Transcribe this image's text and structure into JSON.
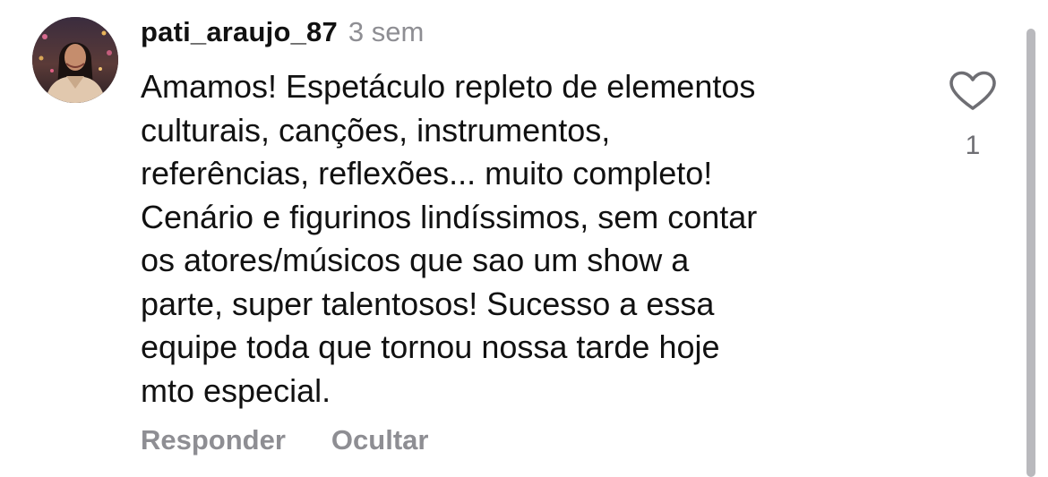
{
  "comment": {
    "username": "pati_araujo_87",
    "timestamp": "3 sem",
    "avatar_icon": "profile-photo-avatar",
    "body_lines": [
      "Amamos! Espetáculo repleto de elementos",
      "culturais, canções, instrumentos,",
      "referências, reflexões... muito completo!",
      "Cenário e figurinos lindíssimos, sem contar",
      "os atores/músicos que sao um show a",
      "parte, super talentosos! Sucesso a essa",
      "equipe toda que tornou nossa tarde hoje",
      "mto especial."
    ],
    "actions": {
      "reply": "Responder",
      "hide": "Ocultar"
    },
    "like": {
      "icon": "heart-outline-icon",
      "count": "1"
    }
  },
  "colors": {
    "text": "#111111",
    "secondary_text": "#8e8e93",
    "icon": "#6e6e73",
    "scrollbar": "#b9b9bd",
    "background": "#ffffff"
  }
}
